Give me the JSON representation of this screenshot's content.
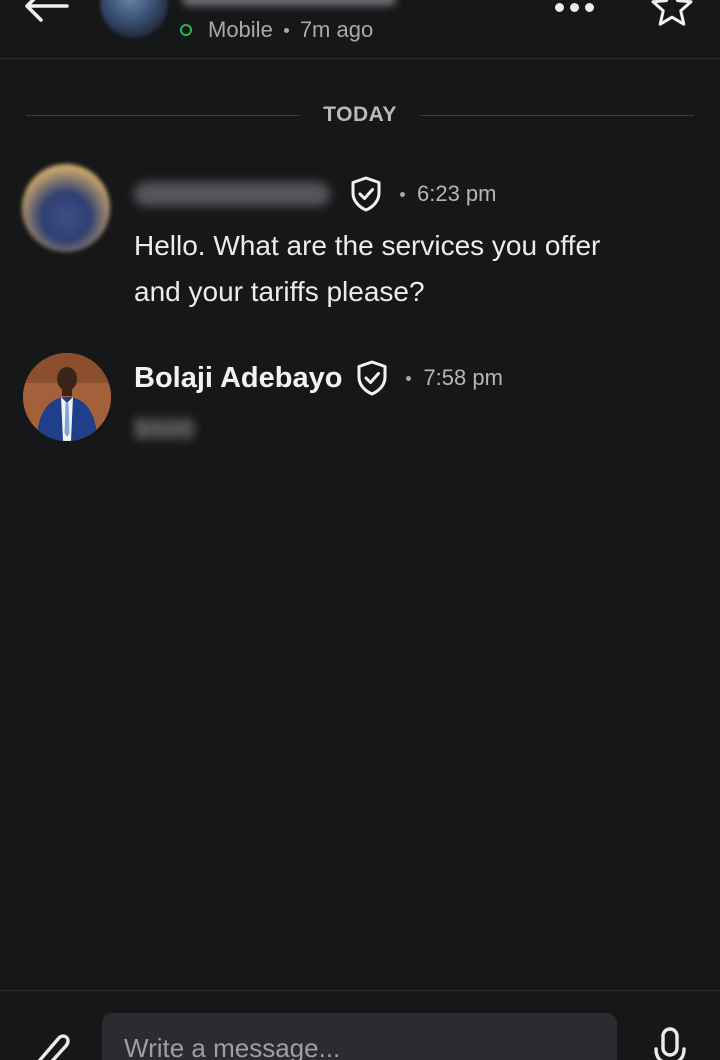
{
  "header": {
    "status": "Mobile",
    "last_seen": "7m ago",
    "icons": {
      "back": "arrow-left-icon",
      "more": "more-horizontal-icon",
      "favorite": "star-icon"
    }
  },
  "conversation": {
    "day_label": "TODAY",
    "messages": [
      {
        "sender": "",
        "verified": true,
        "time": "6:23 pm",
        "text": "Hello. What are the services you offer and your tariffs please?"
      },
      {
        "sender": "Bolaji Adebayo",
        "verified": true,
        "time": "7:58 pm",
        "text": "$500"
      }
    ]
  },
  "composer": {
    "placeholder": "Write a message...",
    "icons": {
      "attach": "paperclip-icon",
      "voice": "microphone-icon"
    }
  },
  "colors": {
    "background": "#161718",
    "online": "#2fb44a",
    "input_background": "#2b2c2f"
  }
}
